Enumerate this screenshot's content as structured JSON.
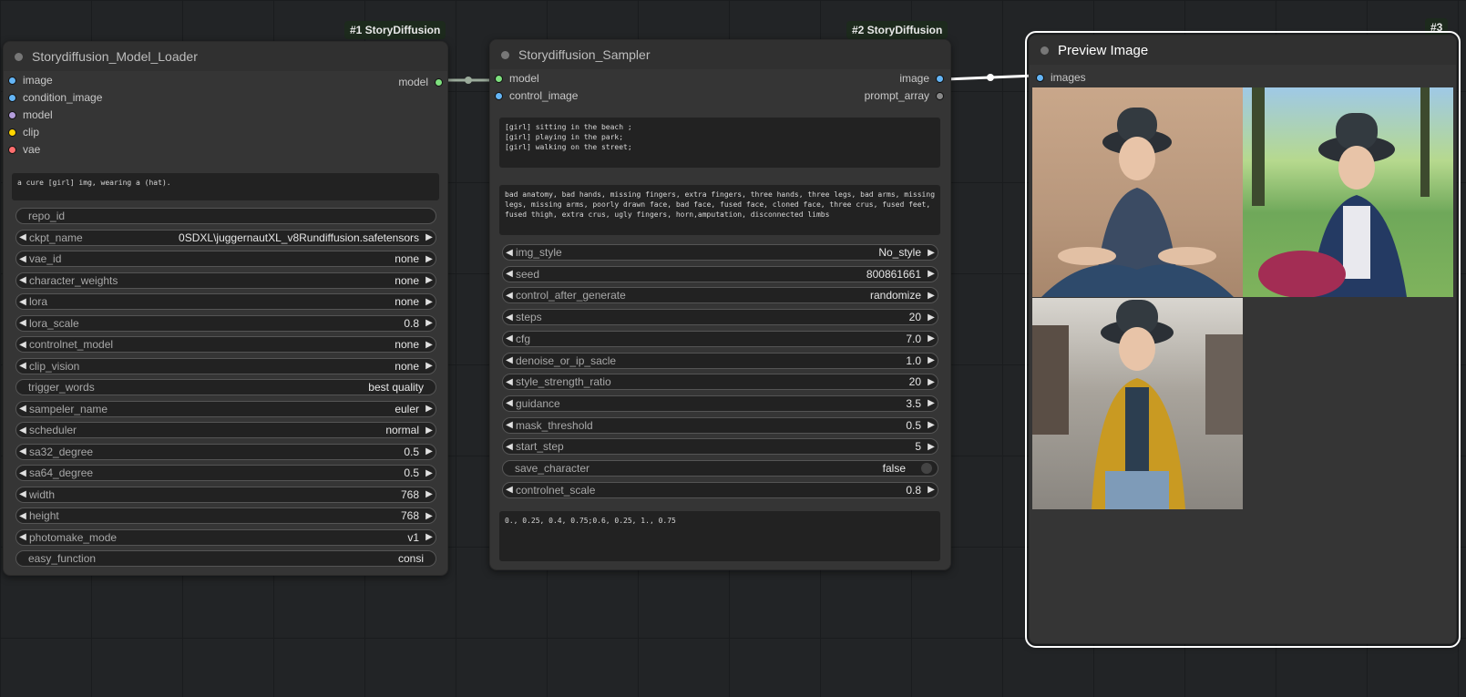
{
  "node1": {
    "badge": "#1 StoryDiffusion",
    "title": "Storydiffusion_Model_Loader",
    "inputs": [
      "image",
      "condition_image",
      "model",
      "clip",
      "vae"
    ],
    "output": "model",
    "prompt": "a cure [girl] img, wearing a (hat).",
    "widgets": [
      {
        "label": "repo_id",
        "value": ""
      },
      {
        "label": "ckpt_name",
        "value": "0SDXL\\juggernautXL_v8Rundiffusion.safetensors"
      },
      {
        "label": "vae_id",
        "value": "none"
      },
      {
        "label": "character_weights",
        "value": "none"
      },
      {
        "label": "lora",
        "value": "none"
      },
      {
        "label": "lora_scale",
        "value": "0.8"
      },
      {
        "label": "controlnet_model",
        "value": "none"
      },
      {
        "label": "clip_vision",
        "value": "none"
      },
      {
        "label": "trigger_words",
        "value": "best quality"
      },
      {
        "label": "sampeler_name",
        "value": "euler"
      },
      {
        "label": "scheduler",
        "value": "normal"
      },
      {
        "label": "sa32_degree",
        "value": "0.5"
      },
      {
        "label": "sa64_degree",
        "value": "0.5"
      },
      {
        "label": "width",
        "value": "768"
      },
      {
        "label": "height",
        "value": "768"
      },
      {
        "label": "photomake_mode",
        "value": "v1"
      },
      {
        "label": "easy_function",
        "value": "consi"
      }
    ]
  },
  "node2": {
    "badge": "#2 StoryDiffusion",
    "title": "Storydiffusion_Sampler",
    "inputs": [
      "model",
      "control_image"
    ],
    "outputs": [
      "image",
      "prompt_array"
    ],
    "prompt": "[girl] sitting in the beach ;\n[girl] playing in the park;\n[girl] walking on the street;",
    "negative": "bad anatomy, bad hands, missing fingers, extra fingers, three hands, three legs, bad arms, missing legs, missing arms, poorly drawn face, bad face, fused face, cloned face, three crus, fused feet, fused thigh, extra crus, ugly fingers, horn,amputation, disconnected limbs",
    "widgets": [
      {
        "label": "img_style",
        "value": "No_style"
      },
      {
        "label": "seed",
        "value": "800861661"
      },
      {
        "label": "control_after_generate",
        "value": "randomize"
      },
      {
        "label": "steps",
        "value": "20"
      },
      {
        "label": "cfg",
        "value": "7.0"
      },
      {
        "label": "denoise_or_ip_sacle",
        "value": "1.0"
      },
      {
        "label": "style_strength_ratio",
        "value": "20"
      },
      {
        "label": "guidance",
        "value": "3.5"
      },
      {
        "label": "mask_threshold",
        "value": "0.5"
      },
      {
        "label": "start_step",
        "value": "5"
      },
      {
        "label": "save_character",
        "value": "false"
      },
      {
        "label": "controlnet_scale",
        "value": "0.8"
      }
    ],
    "controlnet_text": "0., 0.25, 0.4, 0.75;0.6, 0.25, 1., 0.75"
  },
  "node3": {
    "badge": "#3",
    "title": "Preview Image",
    "input": "images"
  },
  "colors": {
    "canvas": "#222426",
    "node_body": "#353535",
    "node_header": "#303030",
    "port_image": "#64b5f6",
    "port_model": "#7ee07e",
    "port_clip": "#ffd500",
    "port_vae": "#ff6e6e",
    "port_model_in": "#b39ddb",
    "selected_outline": "#ffffff"
  }
}
